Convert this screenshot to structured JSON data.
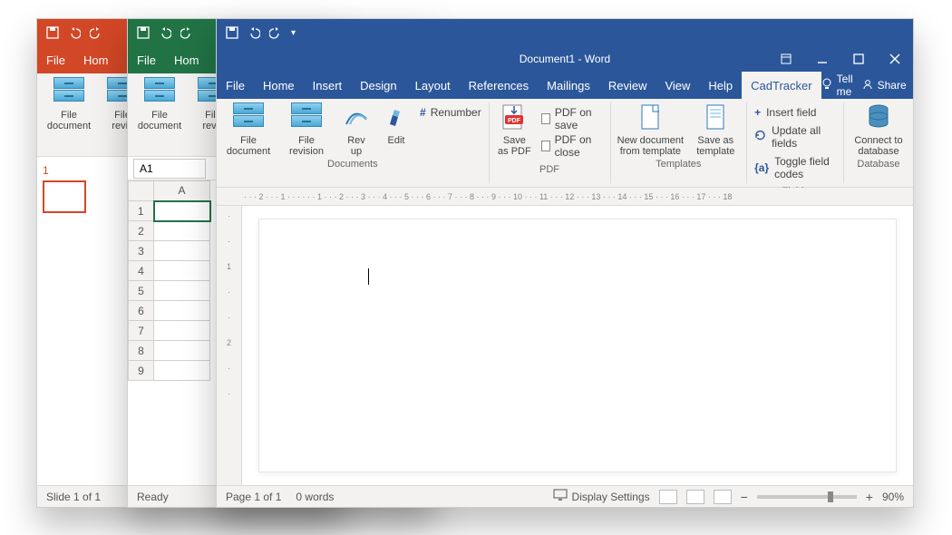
{
  "powerpoint": {
    "tabs": {
      "file": "File",
      "home": "Hom"
    },
    "ribbon": {
      "file_document": "File\ndocument",
      "file_revision": "File\nrevis"
    },
    "slide_number": "1",
    "status": "Slide 1 of 1"
  },
  "excel": {
    "tabs": {
      "file": "File",
      "home": "Hom"
    },
    "ribbon": {
      "file_document": "File\ndocument",
      "file_revision": "File\nrevis"
    },
    "namebox": "A1",
    "col_headers": [
      "A"
    ],
    "row_headers": [
      "1",
      "2",
      "3",
      "4",
      "5",
      "6",
      "7",
      "8",
      "9"
    ],
    "status": "Ready"
  },
  "word": {
    "title": "Document1 - Word",
    "tabs": {
      "file": "File",
      "home": "Home",
      "insert": "Insert",
      "design": "Design",
      "layout": "Layout",
      "references": "References",
      "mailings": "Mailings",
      "review": "Review",
      "view": "View",
      "help": "Help",
      "cadtracker": "CadTracker"
    },
    "tellme": "Tell me",
    "share": "Share",
    "ribbon": {
      "documents": {
        "label": "Documents",
        "file_document": "File\ndocument",
        "file_revision": "File\nrevision",
        "rev_up": "Rev\nup",
        "edit": "Edit",
        "renumber": "Renumber"
      },
      "pdf": {
        "label": "PDF",
        "save_as_pdf": "Save\nas PDF",
        "pdf_on_save": "PDF on save",
        "pdf_on_close": "PDF on close"
      },
      "templates": {
        "label": "Templates",
        "new_from_template": "New document\nfrom template",
        "save_as_template": "Save as\ntemplate"
      },
      "fields": {
        "label": "Fields",
        "insert_field": "Insert field",
        "update_all": "Update all fields",
        "toggle_codes": "Toggle field codes"
      },
      "database": {
        "label": "Database",
        "connect": "Connect to\ndatabase"
      }
    },
    "ruler_h": "· · · 2 · · · 1 · · ·  · · · 1 · · · 2 · · · 3 · · · 4 · · · 5 · · · 6 · · · 7 · · · 8 · · · 9 · · · 10 · · · 11 · · · 12 · · · 13 · · · 14 · · · 15 · · · 16 · · · 17 · · · 18",
    "ruler_v": [
      "·",
      "·",
      "1",
      "·",
      "·",
      "2",
      "·",
      "·"
    ],
    "status": {
      "page": "Page 1 of 1",
      "words": "0 words",
      "display_settings": "Display Settings",
      "zoom": "90%"
    }
  }
}
